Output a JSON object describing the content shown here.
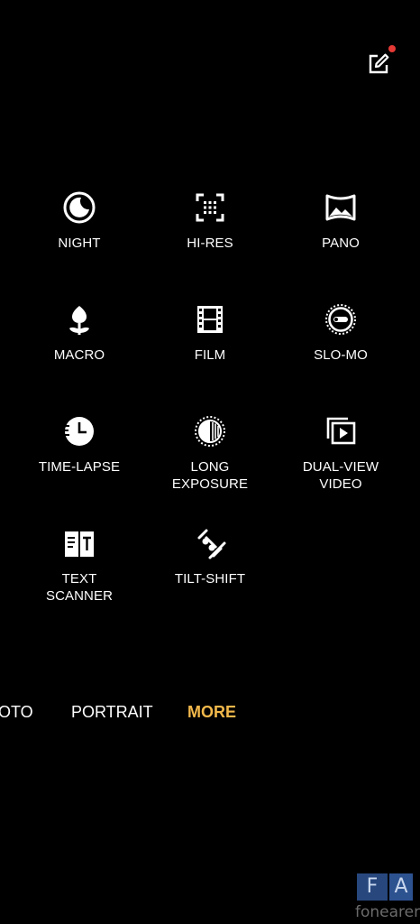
{
  "header": {
    "edit_icon": "edit-icon",
    "notification_dot_color": "#e53935"
  },
  "modes": [
    {
      "icon": "night-icon",
      "label": "NIGHT"
    },
    {
      "icon": "hi-res-icon",
      "label": "HI-RES"
    },
    {
      "icon": "pano-icon",
      "label": "PANO"
    },
    {
      "icon": "macro-icon",
      "label": "MACRO"
    },
    {
      "icon": "film-icon",
      "label": "FILM"
    },
    {
      "icon": "slo-mo-icon",
      "label": "SLO-MO"
    },
    {
      "icon": "time-lapse-icon",
      "label": "TIME-LAPSE"
    },
    {
      "icon": "long-exposure-icon",
      "label_line1": "LONG",
      "label_line2": "EXPOSURE"
    },
    {
      "icon": "dual-view-video-icon",
      "label_line1": "DUAL-VIEW",
      "label_line2": "VIDEO"
    },
    {
      "icon": "text-scanner-icon",
      "label_line1": "TEXT",
      "label_line2": "SCANNER"
    },
    {
      "icon": "tilt-shift-icon",
      "label": "TILT-SHIFT"
    }
  ],
  "tabs": [
    {
      "label": "OTO"
    },
    {
      "label": "PORTRAIT"
    },
    {
      "label": "MORE",
      "active": true
    }
  ],
  "accent_color": "#f2b84b",
  "watermark": {
    "letters_1": "F",
    "letters_2": "A",
    "text": "fonearena"
  }
}
